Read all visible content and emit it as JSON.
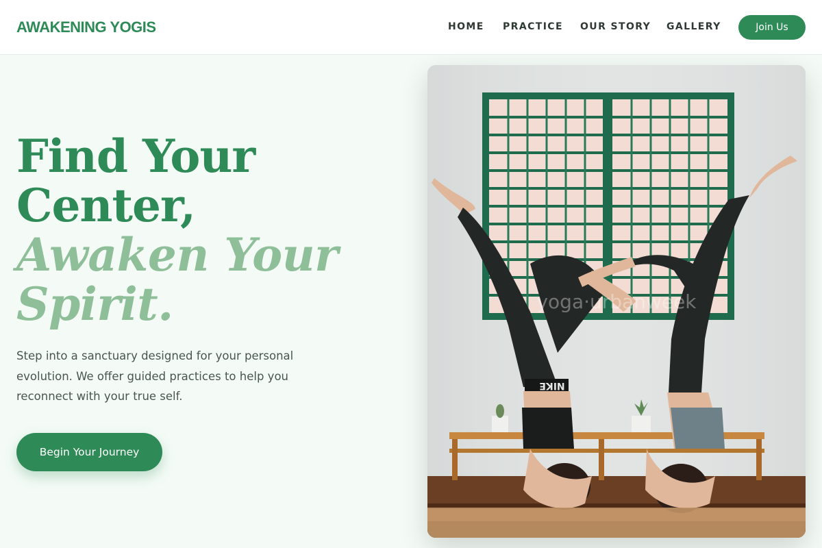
{
  "header": {
    "logo": "AWAKENING YOGIS",
    "nav": [
      "HOME",
      "PRACTICE",
      "OUR STORY",
      "GALLERY"
    ],
    "join_label": "Join Us"
  },
  "hero": {
    "headline_line1": "Find Your",
    "headline_line2": "Center,",
    "headline_line3": "Awaken Your",
    "headline_line4": "Spirit.",
    "lead": "Step into a sanctuary designed for your personal evolution. We offer guided practices to help you reconnect with your true self.",
    "cta_label": "Begin Your Journey",
    "image_watermark": "yoga·urbanweek",
    "image_text_waistband": "NIKE"
  },
  "colors": {
    "brand": "#2e8b57",
    "brand_soft": "#8fbf99",
    "page_bg": "#f4fbf6",
    "text": "#4a5550"
  }
}
